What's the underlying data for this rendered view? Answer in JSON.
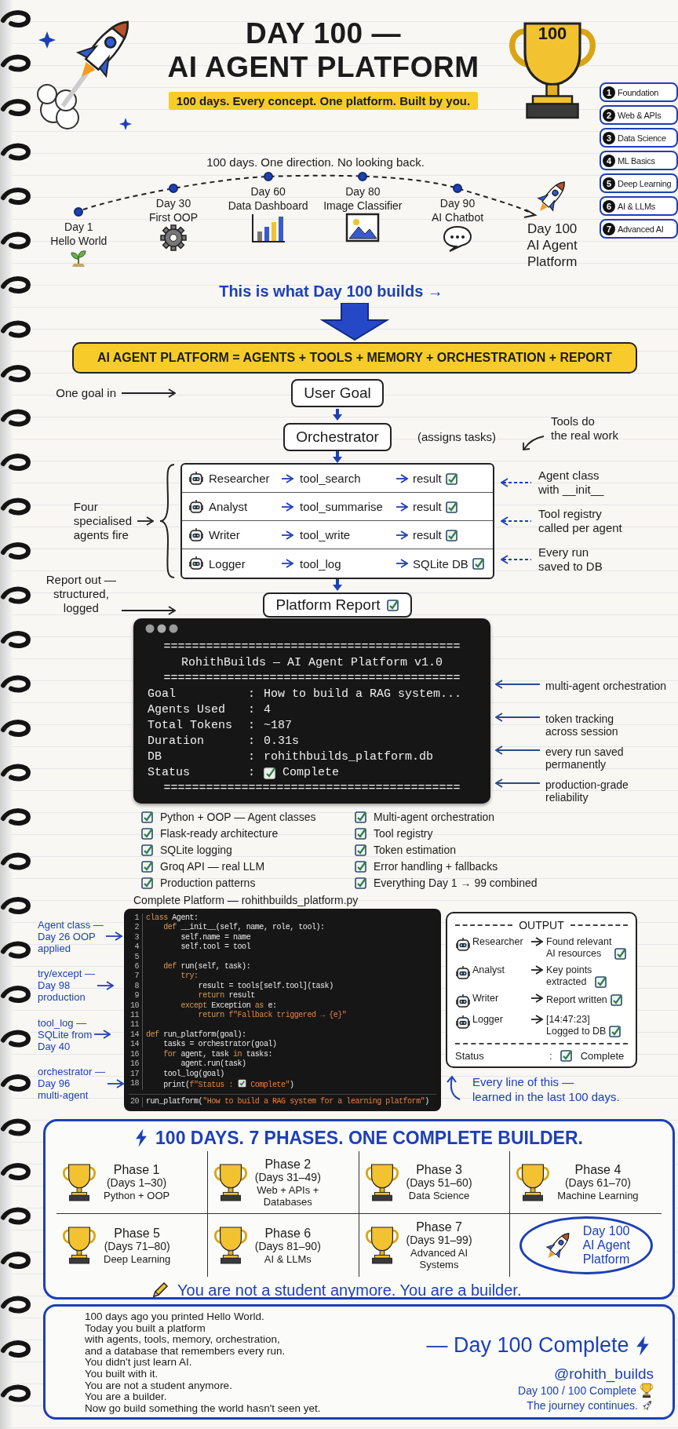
{
  "header": {
    "title": "DAY 100 —\nAI AGENT PLATFORM",
    "tagline": "100 days. Every concept. One platform. Built by you.",
    "trophy_label": "100"
  },
  "phases_legend": [
    {
      "number": "1",
      "label": "Foundation"
    },
    {
      "number": "2",
      "label": "Web & APIs"
    },
    {
      "number": "3",
      "label": "Data Science"
    },
    {
      "number": "4",
      "label": "ML Basics"
    },
    {
      "number": "5",
      "label": "Deep Learning"
    },
    {
      "number": "6",
      "label": "AI & LLMs"
    },
    {
      "number": "7",
      "label": "Advanced AI"
    }
  ],
  "timeline": {
    "caption": "100 days. One direction. No looking back.",
    "milestones": [
      {
        "day": "Day 1",
        "label": "Hello World"
      },
      {
        "day": "Day 30",
        "label": "First OOP"
      },
      {
        "day": "Day 60",
        "label": "Data Dashboard"
      },
      {
        "day": "Day 80",
        "label": "Image Classifier"
      },
      {
        "day": "Day 90",
        "label": "AI Chatbot"
      }
    ],
    "goal": {
      "day": "Day 100",
      "label": "AI Agent\nPlatform"
    }
  },
  "builds_caption": "This is what Day 100 builds →",
  "formula": "AI AGENT PLATFORM = AGENTS + TOOLS + MEMORY + ORCHESTRATION + REPORT",
  "flow": {
    "input_note": "One goal in",
    "user_goal": "User Goal",
    "orchestrator": "Orchestrator",
    "orchestrator_note": "(assigns tasks)",
    "tools_note": "Tools do\nthe real work",
    "agents_note": "Four\nspecialised\nagents fire",
    "agents": [
      {
        "name": "Researcher",
        "tool": "tool_search",
        "result": "result",
        "checked": true
      },
      {
        "name": "Analyst",
        "tool": "tool_summarise",
        "result": "result",
        "checked": true
      },
      {
        "name": "Writer",
        "tool": "tool_write",
        "result": "result",
        "checked": true
      },
      {
        "name": "Logger",
        "tool": "tool_log",
        "result": "SQLite DB",
        "checked": true
      }
    ],
    "side_notes": [
      "Agent class\nwith __init__",
      "Tool registry\ncalled per agent",
      "Every run\nsaved to DB"
    ],
    "report_note": "Report out —\nstructured,\nlogged",
    "report": "Platform Report",
    "report_checked": true
  },
  "terminal": {
    "lines": [
      {
        "kind": "rule",
        "text": "=========================================="
      },
      {
        "kind": "title",
        "text": "RohithBuilds — AI Agent Platform v1.0"
      },
      {
        "kind": "rule",
        "text": "=========================================="
      },
      {
        "kind": "field",
        "label": "Goal",
        "separator": ":",
        "value": "How to build a RAG system..."
      },
      {
        "kind": "field",
        "label": "Agents Used",
        "separator": ":",
        "value": "4"
      },
      {
        "kind": "field",
        "label": "Total Tokens",
        "separator": ":",
        "value": "~187"
      },
      {
        "kind": "field",
        "label": "Duration",
        "separator": ":",
        "value": "0.31s"
      },
      {
        "kind": "field",
        "label": "DB",
        "separator": ":",
        "value": "rohithbuilds_platform.db"
      },
      {
        "kind": "field",
        "label": "Status",
        "separator": ":",
        "value": "Complete",
        "checked": true
      },
      {
        "kind": "rule",
        "text": "=========================================="
      }
    ],
    "annotations": [
      "multi-agent orchestration",
      "token tracking\nacross session",
      "every run saved\npermanently",
      "production-grade\nreliability"
    ]
  },
  "checklist": [
    {
      "text": "Python + OOP — Agent classes",
      "checked": true
    },
    {
      "text": "Flask-ready architecture",
      "checked": true
    },
    {
      "text": "SQLite logging",
      "checked": true
    },
    {
      "text": "Groq API — real LLM",
      "checked": true
    },
    {
      "text": "Production patterns",
      "checked": true
    },
    {
      "text": "Multi-agent orchestration",
      "checked": true
    },
    {
      "text": "Tool registry",
      "checked": true
    },
    {
      "text": "Token estimation",
      "checked": true
    },
    {
      "text": "Error handling + fallbacks",
      "checked": true
    },
    {
      "text": "Everything Day 1 → 99 combined",
      "checked": true
    }
  ],
  "code": {
    "title": "Complete Platform — rohithbuilds_platform.py",
    "annotations": [
      "Agent class —\nDay 26 OOP\napplied",
      "try/except —\nDay 98\nproduction",
      "tool_log —\nSQLite from\nDay 40",
      "orchestrator —\nDay 96\nmulti-agent"
    ],
    "lines": [
      {
        "number": "1",
        "segments": [
          {
            "kind": "keyword",
            "text": "class"
          },
          {
            "kind": "plain",
            "text": " Agent:"
          }
        ]
      },
      {
        "number": "2",
        "segments": [
          {
            "kind": "keyword",
            "text": "    def"
          },
          {
            "kind": "plain",
            "text": " __init__(self, name, role, tool):"
          }
        ]
      },
      {
        "number": "3",
        "segments": [
          {
            "kind": "plain",
            "text": "        self.name = name"
          }
        ]
      },
      {
        "number": "4",
        "segments": [
          {
            "kind": "plain",
            "text": "        self.tool = tool"
          }
        ]
      },
      {
        "number": "5"
      },
      {
        "number": "6",
        "segments": [
          {
            "kind": "keyword",
            "text": "    def"
          },
          {
            "kind": "plain",
            "text": " run(self, task):"
          }
        ]
      },
      {
        "number": "7",
        "segments": [
          {
            "kind": "keyword",
            "text": "        try:"
          }
        ]
      },
      {
        "number": "8",
        "segments": [
          {
            "kind": "plain",
            "text": "            result = tools[self.tool](task)"
          }
        ]
      },
      {
        "number": "9",
        "segments": [
          {
            "kind": "keyword",
            "text": "            return"
          },
          {
            "kind": "plain",
            "text": " result"
          }
        ]
      },
      {
        "number": "10",
        "segments": [
          {
            "kind": "keyword",
            "text": "        except"
          },
          {
            "kind": "plain",
            "text": " Exception "
          },
          {
            "kind": "keyword",
            "text": "as"
          },
          {
            "kind": "plain",
            "text": " e:"
          }
        ]
      },
      {
        "number": "11",
        "segments": [
          {
            "kind": "keyword",
            "text": "            return"
          },
          {
            "kind": "string",
            "text": " f\"Fallback triggered → {e}\""
          }
        ]
      },
      {
        "number": "11"
      },
      {
        "number": "14",
        "segments": [
          {
            "kind": "keyword",
            "text": "def"
          },
          {
            "kind": "plain",
            "text": " run_platform(goal):"
          }
        ]
      },
      {
        "number": "14",
        "segments": [
          {
            "kind": "plain",
            "text": "    tasks = orchestrator(goal)"
          }
        ]
      },
      {
        "number": "16",
        "segments": [
          {
            "kind": "keyword",
            "text": "    for"
          },
          {
            "kind": "plain",
            "text": " agent, task "
          },
          {
            "kind": "keyword",
            "text": "in"
          },
          {
            "kind": "plain",
            "text": " tasks:"
          }
        ]
      },
      {
        "number": "16",
        "segments": [
          {
            "kind": "plain",
            "text": "        agent.run(task)"
          }
        ]
      },
      {
        "number": "17",
        "segments": [
          {
            "kind": "plain",
            "text": "    tool_log(goal)"
          }
        ]
      },
      {
        "number": "18",
        "segments": [
          {
            "kind": "plain",
            "text": "    print("
          },
          {
            "kind": "string",
            "text": "f\"Status : "
          },
          {
            "kind": "check"
          },
          {
            "kind": "string",
            "text": " Complete\""
          },
          {
            "kind": "plain",
            "text": ")"
          }
        ]
      },
      {
        "number": "20",
        "segments": [
          {
            "kind": "plain",
            "text": "run_platform("
          },
          {
            "kind": "string",
            "text": "\"How to build a RAG system for a learning platform\""
          },
          {
            "kind": "plain",
            "text": ")"
          }
        ]
      }
    ]
  },
  "output": {
    "title": "OUTPUT",
    "rows": [
      {
        "agent": "Researcher",
        "result": "Found relevant\nAI resources",
        "checked": true
      },
      {
        "agent": "Analyst",
        "result": "Key points\nextracted",
        "checked": true
      },
      {
        "agent": "Writer",
        "result": "Report written",
        "checked": true
      },
      {
        "agent": "Logger",
        "result": "[14:47:23]\nLogged to DB",
        "checked": true
      }
    ],
    "status": {
      "label": "Status",
      "separator": ":",
      "value": "Complete",
      "checked": true
    },
    "caption": "Every line of this —\nlearned in the last 100 days."
  },
  "phases": {
    "title": "100 DAYS. 7 PHASES. ONE COMPLETE BUILDER.",
    "items": [
      {
        "title": "Phase 1",
        "days": "(Days 1–30)",
        "topic": "Python + OOP"
      },
      {
        "title": "Phase 2",
        "days": "(Days 31–49)",
        "topic": "Web + APIs +\nDatabases"
      },
      {
        "title": "Phase 3",
        "days": "(Days 51–60)",
        "topic": "Data Science"
      },
      {
        "title": "Phase 4",
        "days": "(Days 61–70)",
        "topic": "Machine Learning"
      },
      {
        "title": "Phase 5",
        "days": "(Days 71–80)",
        "topic": "Deep Learning"
      },
      {
        "title": "Phase 6",
        "days": "(Days 81–90)",
        "topic": "AI & LLMs"
      },
      {
        "title": "Phase 7",
        "days": "(Days 91–99)",
        "topic": "Advanced AI\nSystems"
      }
    ],
    "final": "Day 100\nAI Agent\nPlatform",
    "motto": "You are not a student anymore. You are a builder."
  },
  "footer": {
    "message": "100 days ago you printed Hello World.\nToday you built a platform\nwith agents, tools, memory, orchestration,\nand a database that remembers every run.\nYou didn't just learn AI.\nYou built with it.\nYou are not a student anymore.\nYou are a builder.\nNow go build something the world hasn't seen yet.",
    "signoff": "— Day 100 Complete",
    "handle": "@rohith_builds",
    "progress": "Day 100 / 100 Complete",
    "journey": "The journey continues."
  }
}
